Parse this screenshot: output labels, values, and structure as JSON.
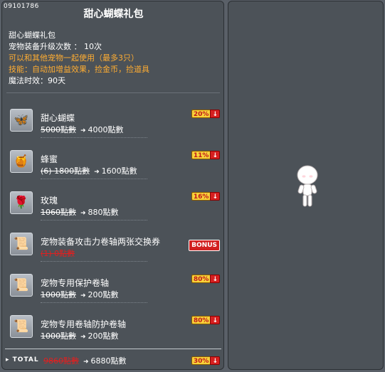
{
  "header": {
    "code": "09101786",
    "title": "甜心蝴蝶礼包"
  },
  "description": {
    "name": "甜心蝴蝶礼包",
    "upgrade": "宠物装备升级次数 ： 10次",
    "usable": "可以和其他宠物一起使用（最多3只）",
    "skill": "技能：自动加增益效果，捡金币，捡道具",
    "duration": "魔法时效：90天"
  },
  "items": [
    {
      "icon": "butterfly-pet-icon",
      "glyph": "🦋",
      "name": "甜心蝴蝶",
      "old_price": "5000點數",
      "new_price": "4000點數",
      "badge": "20%"
    },
    {
      "icon": "honey-icon",
      "glyph": "🍯",
      "name": "蜂蜜",
      "old_price": "(6) 1800點數",
      "new_price": "1600點數",
      "badge": "11%"
    },
    {
      "icon": "rose-icon",
      "glyph": "🌹",
      "name": "玫瑰",
      "old_price": "1060點數",
      "new_price": "880點數",
      "badge": "16%"
    },
    {
      "icon": "exchange-coupon-icon",
      "glyph": "📜",
      "name": "宠物装备攻击力卷轴两张交换券",
      "old_price": "(1) 0點數",
      "new_price": "",
      "badge": "",
      "bonus": "BONUS"
    },
    {
      "icon": "protect-scroll-icon",
      "glyph": "📜",
      "name": "宠物专用保护卷轴",
      "old_price": "1000點數",
      "new_price": "200點數",
      "badge": "80%"
    },
    {
      "icon": "scroll-protect-scroll-icon",
      "glyph": "📜",
      "name": "宠物专用卷轴防护卷轴",
      "old_price": "1000點數",
      "new_price": "200點數",
      "badge": "80%"
    }
  ],
  "total": {
    "label": "TOTAL",
    "old_price": "9860點數",
    "new_price": "6880點數",
    "badge": "30%"
  },
  "preview": {
    "character": "default-character-preview"
  },
  "colors": {
    "panel": "#4c5258",
    "background": "#5a6068",
    "orange": "#ffad32",
    "red": "#e02020",
    "badge_yellow": "#f7d23a"
  }
}
